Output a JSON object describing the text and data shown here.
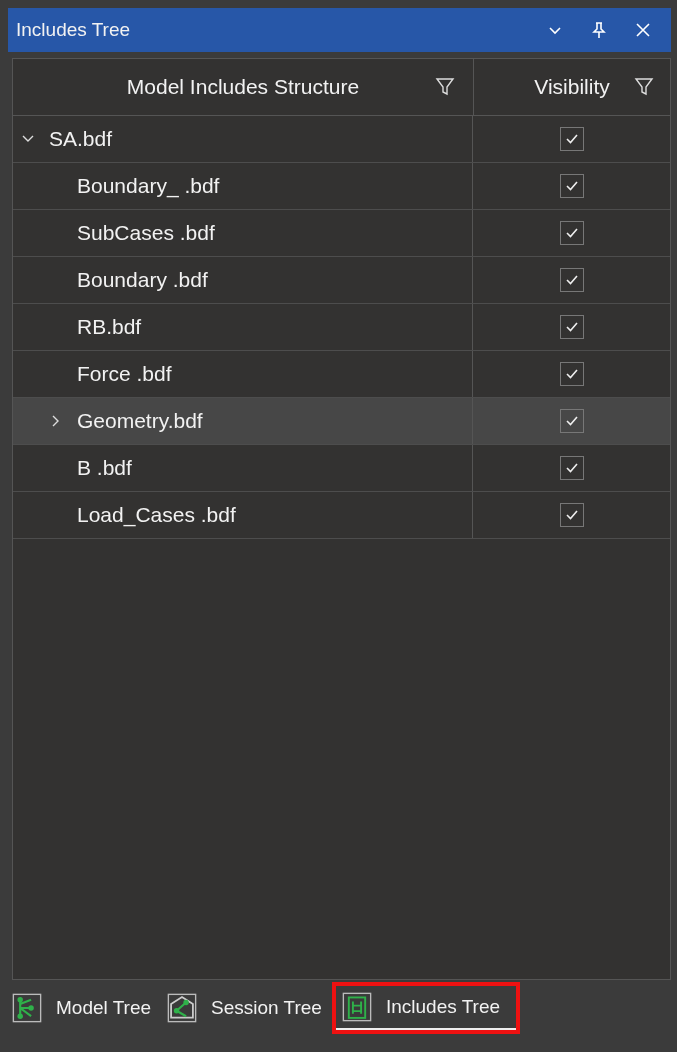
{
  "window": {
    "title": "Includes Tree"
  },
  "table": {
    "columns": [
      {
        "label": "Model Includes Structure"
      },
      {
        "label": "Visibility"
      }
    ],
    "rows": [
      {
        "name": "SA.bdf",
        "checked": true,
        "selected": false,
        "expanded": true,
        "children": [
          {
            "name": "Boundary_ .bdf",
            "checked": true,
            "selected": false
          },
          {
            "name": "SubCases .bdf",
            "checked": true,
            "selected": false
          },
          {
            "name": "Boundary .bdf",
            "checked": true,
            "selected": false
          },
          {
            "name": "RB.bdf",
            "checked": true,
            "selected": false
          },
          {
            "name": "Force .bdf",
            "checked": true,
            "selected": false
          },
          {
            "name": "Geometry.bdf",
            "checked": true,
            "selected": true,
            "expanded": false
          },
          {
            "name": "B .bdf",
            "checked": true,
            "selected": false
          },
          {
            "name": "Load_Cases .bdf",
            "checked": true,
            "selected": false
          }
        ]
      }
    ]
  },
  "bottom_tabs": [
    {
      "label": "Model Tree",
      "selected": false,
      "highlighted": false
    },
    {
      "label": "Session Tree",
      "selected": false,
      "highlighted": false
    },
    {
      "label": "Includes Tree",
      "selected": true,
      "highlighted": true
    }
  ]
}
